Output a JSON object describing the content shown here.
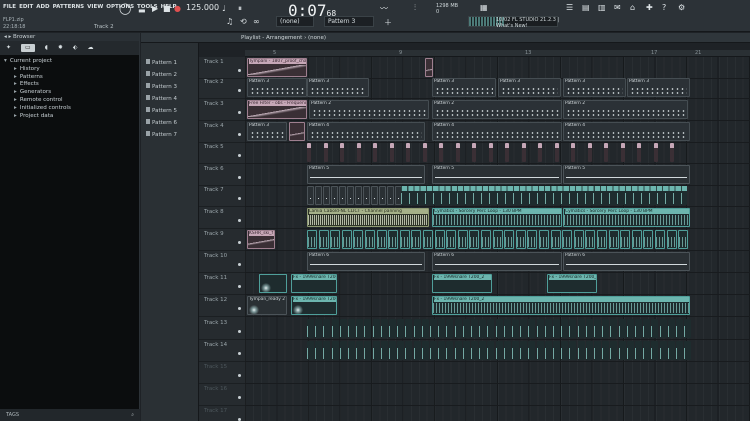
{
  "menu": [
    "FILE",
    "EDIT",
    "ADD",
    "PATTERNS",
    "VIEW",
    "OPTIONS",
    "TOOLS",
    "HELP"
  ],
  "project": {
    "file": "FLP1.zip",
    "clock": "22:18:18"
  },
  "toolbar": {
    "track_hint": "Track 2",
    "tempo": "125.000",
    "time_main": "0:07",
    "time_sub": "68",
    "none_selector": "(none)",
    "pattern_selector": "Pattern 3",
    "cpu_line1": "1298 MB",
    "cpu_line2": "0",
    "news_line1": "10/02  FL STUDIO 21.2.3 |",
    "news_line2": "What's New!"
  },
  "browser": {
    "title": "Browser",
    "tree": [
      {
        "label": "Current project",
        "child": false
      },
      {
        "label": "History",
        "child": true
      },
      {
        "label": "Patterns",
        "child": true
      },
      {
        "label": "Effects",
        "child": true
      },
      {
        "label": "Generators",
        "child": true
      },
      {
        "label": "Remote control",
        "child": true
      },
      {
        "label": "Initialized controls",
        "child": true
      },
      {
        "label": "Project data",
        "child": true
      }
    ],
    "tags": "TAGS"
  },
  "picker": [
    "Pattern 1",
    "Pattern 2",
    "Pattern 3",
    "Pattern 4",
    "Pattern 5",
    "Pattern 6",
    "Pattern 7"
  ],
  "playlist": {
    "title": "Playlist - Arrangement › (none)",
    "ruler": [
      "5",
      "9",
      "13",
      "17",
      "21"
    ],
    "tracks": [
      "Track 1",
      "Track 2",
      "Track 3",
      "Track 4",
      "Track 5",
      "Track 6",
      "Track 7",
      "Track 8",
      "Track 9",
      "Track 10",
      "Track 11",
      "Track 12",
      "Track 13",
      "Track 14",
      "Track 15",
      "Track 16",
      "Track 17"
    ],
    "clip_labels": {
      "tympani": "Tympani - 1807_proof_channel",
      "pattern3": "Pattern 3",
      "pattern2": "Pattern 2",
      "pattern4": "Pattern 4",
      "pattern5": "Pattern 5",
      "pattern6": "Pattern 6",
      "free_filter": "Free Filter - obs - Frequency",
      "lamia": "Lamia Cabold-NL CLICT - Channel panning",
      "cymatics": "Cymatics - Sorcery Perc Loop - 130 BPM",
      "kshs": "KSHR_ski_f",
      "fx": "Fx - 1999snare T200_2",
      "fx_short": "Fx - 1_150",
      "tympani_short": "Tympan_ready 2"
    }
  },
  "colors": {
    "accent_pink": "#c6a7b7",
    "accent_teal": "#6cb5ae",
    "accent_olive": "#a5b088"
  }
}
